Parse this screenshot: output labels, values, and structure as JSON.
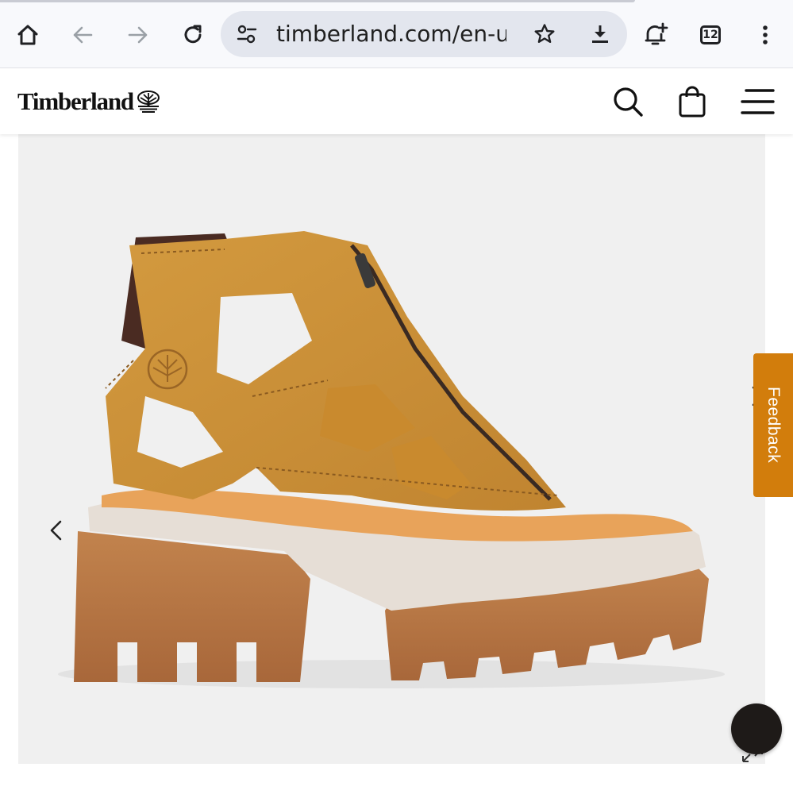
{
  "browser": {
    "url": "timberland.com/en-us",
    "tab_count": "12",
    "icons": [
      "home-icon",
      "back-arrow-icon",
      "forward-arrow-icon",
      "reload-icon",
      "site-settings-icon",
      "bookmark-star-icon",
      "download-icon",
      "add-notification-icon",
      "tab-switcher-icon",
      "more-vertical-icon"
    ]
  },
  "site": {
    "brand": "Timberland",
    "icons": [
      "timberland-tree-logo",
      "search-icon",
      "shopping-bag-icon",
      "hamburger-menu-icon"
    ]
  },
  "product_gallery": {
    "image": "Women's Everleigh Zip-Front Sandal, wheat nubuck",
    "prev_label": "previous-image",
    "next_label": "next-image",
    "expand_label": "expand-image"
  },
  "feedback_tab": {
    "label": "Feedback"
  },
  "colors": {
    "accent": "#d27d0c",
    "gallery_bg": "#f0f0f0",
    "chrome_bg": "#f8f9fc",
    "url_bg": "#e3e6ee"
  }
}
